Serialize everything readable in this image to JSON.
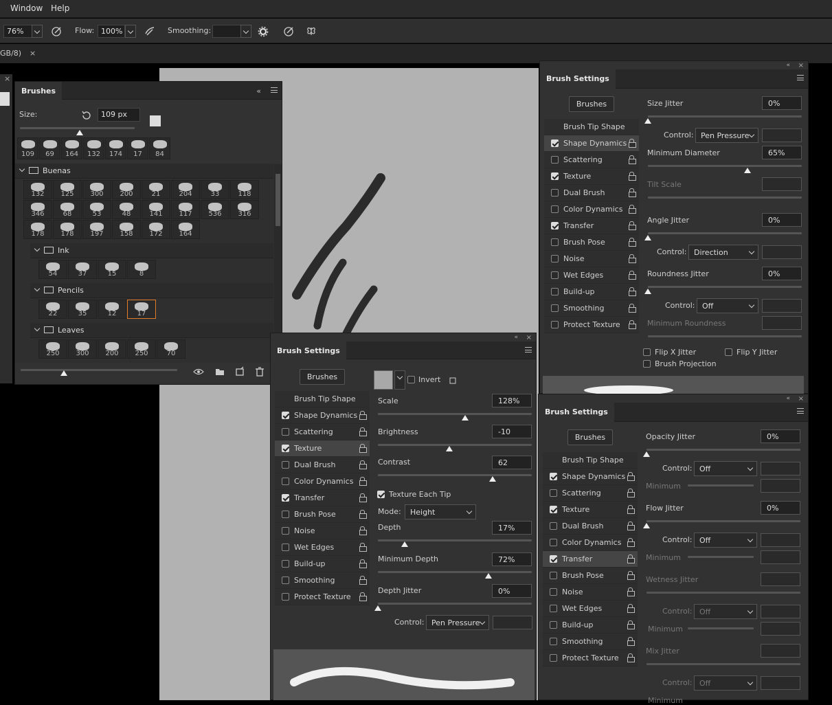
{
  "menu": {
    "window": "Window",
    "help": "Help"
  },
  "options": {
    "zoom": "76%",
    "flow_label": "Flow:",
    "flow": "100%",
    "smoothing_label": "Smoothing:",
    "smoothing": ""
  },
  "doc_tab": {
    "title": "GB/8)",
    "close": "×"
  },
  "brushes_panel": {
    "title": "Brushes",
    "size_label": "Size:",
    "size_value": "109 px",
    "recent": [
      "109",
      "69",
      "164",
      "132",
      "174",
      "17",
      "84"
    ],
    "folders": [
      {
        "name": "Buenas",
        "rows": [
          [
            "132",
            "125",
            "300",
            "200",
            "21",
            "204",
            "33",
            "118"
          ],
          [
            "346",
            "68",
            "53",
            "48",
            "141",
            "117",
            "536",
            "316"
          ],
          [
            "178",
            "178",
            "197",
            "158",
            "172",
            "164"
          ]
        ]
      },
      {
        "name": "Ink",
        "rows": [
          [
            "54",
            "37",
            "15",
            "8"
          ]
        ]
      },
      {
        "name": "Pencils",
        "rows": [
          [
            "22",
            "35",
            "12",
            "17"
          ]
        ]
      },
      {
        "name": "Leaves",
        "rows": [
          [
            "250",
            "300",
            "200",
            "250",
            "70"
          ]
        ]
      }
    ]
  },
  "settings_common": {
    "title": "Brush Settings",
    "brushes_btn": "Brushes",
    "tip_shape": "Brush Tip Shape"
  },
  "settings_list": [
    "Shape Dynamics",
    "Scattering",
    "Texture",
    "Dual Brush",
    "Color Dynamics",
    "Transfer",
    "Brush Pose",
    "Noise",
    "Wet Edges",
    "Build-up",
    "Smoothing",
    "Protect Texture"
  ],
  "panel_texture": {
    "invert": "Invert",
    "scale_label": "Scale",
    "scale": "128%",
    "brightness_label": "Brightness",
    "brightness": "-10",
    "contrast_label": "Contrast",
    "contrast": "62",
    "each_tip": "Texture Each Tip",
    "mode_label": "Mode:",
    "mode": "Height",
    "depth_label": "Depth",
    "depth": "17%",
    "min_depth_label": "Minimum Depth",
    "min_depth": "72%",
    "depth_jitter_label": "Depth Jitter",
    "depth_jitter": "0%",
    "control_label": "Control:",
    "control": "Pen Pressure"
  },
  "panel_shape": {
    "size_jitter_label": "Size Jitter",
    "size_jitter": "0%",
    "control_label": "Control:",
    "control1": "Pen Pressure",
    "min_diam_label": "Minimum Diameter",
    "min_diam": "65%",
    "tilt_label": "Tilt Scale",
    "angle_label": "Angle Jitter",
    "angle": "0%",
    "control2": "Direction",
    "round_label": "Roundness Jitter",
    "round": "0%",
    "control3": "Off",
    "min_round_label": "Minimum Roundness",
    "flipx": "Flip X Jitter",
    "flipy": "Flip Y Jitter",
    "projection": "Brush Projection"
  },
  "panel_transfer": {
    "opacity_label": "Opacity Jitter",
    "opacity": "0%",
    "control_label": "Control:",
    "control1": "Off",
    "min_label": "Minimum",
    "flow_label": "Flow Jitter",
    "flow": "0%",
    "control2": "Off",
    "wet_label": "Wetness Jitter",
    "control3": "Off",
    "mix_label": "Mix Jitter",
    "control4": "Off",
    "min4": "Minimum"
  }
}
